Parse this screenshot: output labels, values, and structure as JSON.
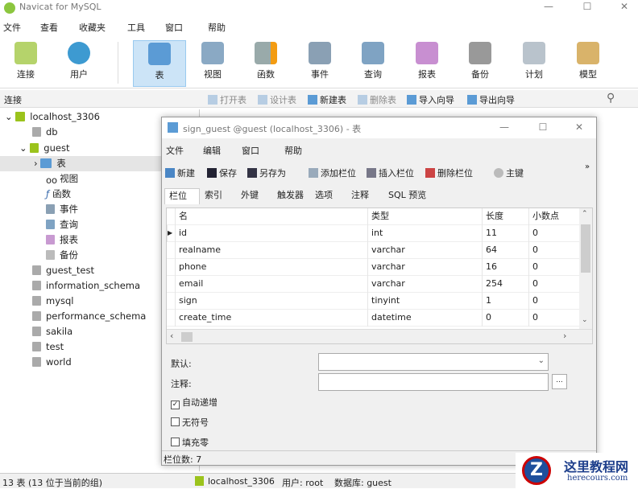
{
  "app": {
    "title": "Navicat for MySQL"
  },
  "menu": [
    "文件",
    "查看",
    "收藏夹",
    "工具",
    "窗口",
    "帮助"
  ],
  "toolbar": [
    "连接",
    "用户",
    "表",
    "视图",
    "函数",
    "事件",
    "查询",
    "报表",
    "备份",
    "计划",
    "模型"
  ],
  "subbar": {
    "label": "连接",
    "actions": [
      "打开表",
      "设计表",
      "新建表",
      "删除表",
      "导入向导",
      "导出向导"
    ]
  },
  "tree": {
    "connection": "localhost_3306",
    "dbs_before": [
      "db"
    ],
    "guest": "guest",
    "guest_children": [
      "表",
      "视图",
      "函数",
      "事件",
      "查询",
      "报表",
      "备份"
    ],
    "dbs_after": [
      "guest_test",
      "information_schema",
      "mysql",
      "performance_schema",
      "sakila",
      "test",
      "world"
    ]
  },
  "dialog": {
    "title": "sign_guest @guest (localhost_3306) - 表",
    "menu": [
      "文件",
      "编辑",
      "窗口",
      "帮助"
    ],
    "toolbar": [
      "新建",
      "保存",
      "另存为",
      "添加栏位",
      "插入栏位",
      "删除栏位",
      "主键"
    ],
    "tabs": [
      "栏位",
      "索引",
      "外键",
      "触发器",
      "选项",
      "注释",
      "SQL 预览"
    ],
    "columns": [
      "名",
      "类型",
      "长度",
      "小数点"
    ],
    "rows": [
      [
        "id",
        "int",
        "11",
        "0"
      ],
      [
        "realname",
        "varchar",
        "64",
        "0"
      ],
      [
        "phone",
        "varchar",
        "16",
        "0"
      ],
      [
        "email",
        "varchar",
        "254",
        "0"
      ],
      [
        "sign",
        "tinyint",
        "1",
        "0"
      ],
      [
        "create_time",
        "datetime",
        "0",
        "0"
      ]
    ],
    "default_label": "默认:",
    "comment_label": "注释:",
    "ellipsis": "...",
    "checkboxes": [
      {
        "label": "自动递增",
        "checked": true
      },
      {
        "label": "无符号",
        "checked": false
      },
      {
        "label": "填充零",
        "checked": false
      }
    ],
    "status": "栏位数: 7"
  },
  "status": {
    "left": "13 表 (13 位于当前的组)",
    "connection": "localhost_3306",
    "user": "用户: root",
    "db": "数据库: guest"
  },
  "watermark": {
    "name": "这里教程网",
    "url": "herecours.com"
  }
}
